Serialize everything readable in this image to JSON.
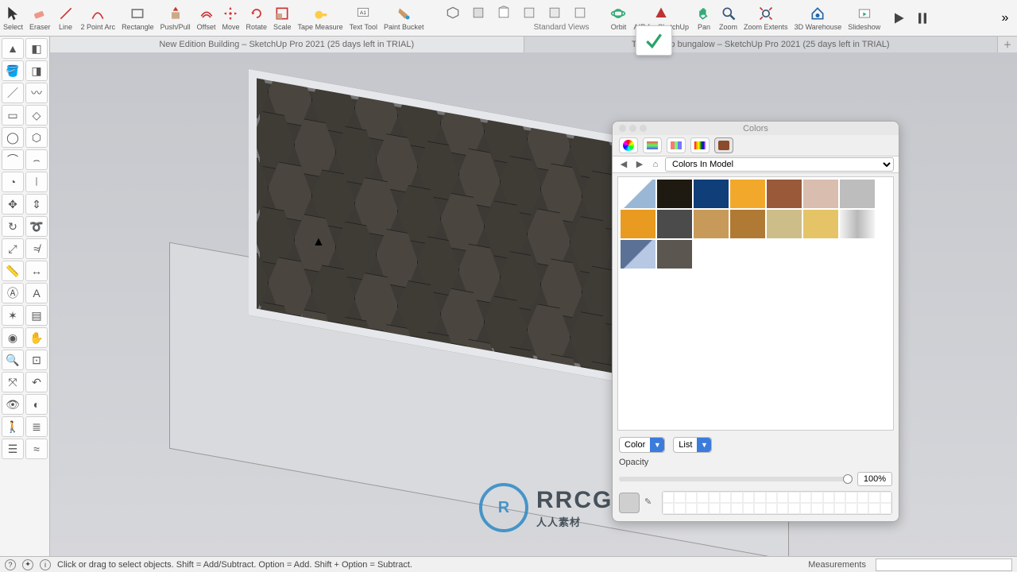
{
  "toolbar": {
    "tools": [
      {
        "label": "Select",
        "icon": "cursor"
      },
      {
        "label": "Eraser",
        "icon": "eraser"
      },
      {
        "label": "Line",
        "icon": "line"
      },
      {
        "label": "2 Point Arc",
        "icon": "arc"
      },
      {
        "label": "Rectangle",
        "icon": "rect"
      },
      {
        "label": "Push/Pull",
        "icon": "pushpull"
      },
      {
        "label": "Offset",
        "icon": "offset"
      },
      {
        "label": "Move",
        "icon": "move"
      },
      {
        "label": "Rotate",
        "icon": "rotate"
      },
      {
        "label": "Scale",
        "icon": "scale"
      },
      {
        "label": "Tape Measure",
        "icon": "tape"
      },
      {
        "label": "Text Tool",
        "icon": "text"
      },
      {
        "label": "Paint Bucket",
        "icon": "paint"
      }
    ],
    "views_label": "Standard Views",
    "view_icons": [
      "iso",
      "top",
      "front",
      "right",
      "back",
      "left"
    ],
    "nav": [
      {
        "label": "Orbit",
        "icon": "orbit"
      },
      {
        "label": "AIR for SketchUp",
        "icon": "air"
      },
      {
        "label": "Pan",
        "icon": "pan"
      },
      {
        "label": "Zoom",
        "icon": "zoom"
      },
      {
        "label": "Zoom Extents",
        "icon": "zoomext"
      },
      {
        "label": "3D Warehouse",
        "icon": "warehouse"
      },
      {
        "label": "Slideshow",
        "icon": "slideshow"
      }
    ],
    "playback": [
      "play",
      "pause"
    ],
    "overflow_icon": "chevrons-right"
  },
  "documents": {
    "tabs": [
      "New Edition Building  – SketchUp Pro 2021 (25 days left in TRIAL)",
      "Trani         tchup bungalow – SketchUp Pro 2021 (25 days left in TRIAL)"
    ],
    "active_index": 0,
    "add_tab_icon": "plus"
  },
  "toolbox": {
    "tools": [
      "select",
      "styles",
      "paint",
      "eraser",
      "line",
      "freehand",
      "rect",
      "rotrect",
      "circle",
      "polygon",
      "arc",
      "2ptarc",
      "pie",
      "3ptarc",
      "move",
      "pushpull",
      "rotate",
      "followme",
      "scale",
      "offset",
      "tape",
      "dimension",
      "text",
      "3dtext",
      "axes",
      "sectionplane",
      "orbit",
      "pan",
      "zoom",
      "zoomwin",
      "zoomext",
      "prev",
      "position",
      "lookaround",
      "walk",
      "layers",
      "outliner",
      "soften"
    ]
  },
  "colors_panel": {
    "title": "Colors",
    "tabs": [
      "wheel",
      "sliders",
      "palettes",
      "spectrum",
      "materials"
    ],
    "active_tab": 4,
    "nav_icons": [
      "back",
      "forward",
      "home"
    ],
    "library_label": "Colors In Model",
    "swatches": [
      {
        "name": "default",
        "color": "linear-gradient(135deg,#ffffff 49%,#9bb7d6 51%)"
      },
      {
        "name": "black-brown",
        "color": "#1f1a11"
      },
      {
        "name": "navy",
        "color": "#0f3e78"
      },
      {
        "name": "amber",
        "color": "#f2a92b"
      },
      {
        "name": "clay",
        "color": "#9a5a3a"
      },
      {
        "name": "beige",
        "color": "#d9bdae"
      },
      {
        "name": "light-gray",
        "color": "#bdbdbd"
      },
      {
        "name": "orange",
        "color": "#e99a20"
      },
      {
        "name": "dark-gray",
        "color": "#4b4b4b"
      },
      {
        "name": "wood-light",
        "color": "#c89a5a"
      },
      {
        "name": "wood-strip",
        "color": "#b07a34"
      },
      {
        "name": "tan",
        "color": "#cdbd88"
      },
      {
        "name": "sand",
        "color": "#e4c467"
      },
      {
        "name": "metal",
        "color": "linear-gradient(90deg,#f4f4f4,#b8b8b8,#f4f4f4)"
      },
      {
        "name": "sky-blue",
        "color": "linear-gradient(135deg,#5b7296 49%,#b6c8e4 51%)"
      },
      {
        "name": "roof-shingle",
        "color": "#5b5750"
      }
    ],
    "color_combo": "Color",
    "list_combo": "List",
    "opacity_label": "Opacity",
    "opacity_value": "100%"
  },
  "status": {
    "hint": "Click or drag to select objects. Shift = Add/Subtract. Option = Add. Shift + Option = Subtract.",
    "icons": [
      "help",
      "person",
      "info"
    ],
    "measurements_label": "Measurements",
    "measurements_value": ""
  },
  "watermark": {
    "main": "RRCG",
    "sub": "人人素材"
  }
}
